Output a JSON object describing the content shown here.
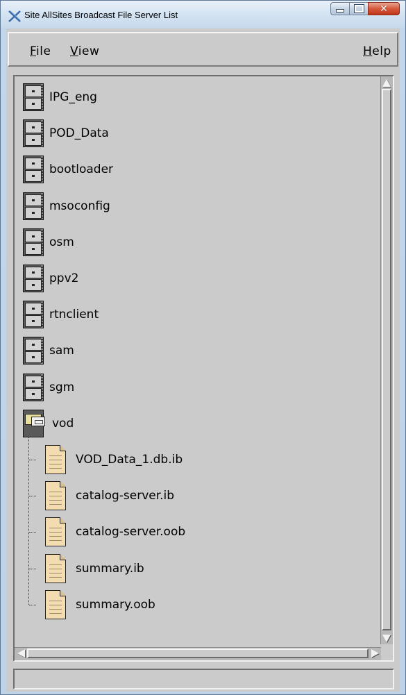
{
  "window": {
    "title": "Site AllSites Broadcast File Server List",
    "controls": {
      "minimize": "minimize",
      "maximize": "maximize",
      "close": "close"
    }
  },
  "menubar": {
    "file": "File",
    "view": "View",
    "help": "Help"
  },
  "servers": [
    {
      "label": "IPG_eng",
      "icon": "file-cabinet-icon"
    },
    {
      "label": "POD_Data",
      "icon": "file-cabinet-icon"
    },
    {
      "label": "bootloader",
      "icon": "file-cabinet-icon"
    },
    {
      "label": "msoconfig",
      "icon": "file-cabinet-icon"
    },
    {
      "label": "osm",
      "icon": "file-cabinet-icon"
    },
    {
      "label": "ppv2",
      "icon": "file-cabinet-icon"
    },
    {
      "label": "rtnclient",
      "icon": "file-cabinet-icon"
    },
    {
      "label": "sam",
      "icon": "file-cabinet-icon"
    },
    {
      "label": "sgm",
      "icon": "file-cabinet-icon"
    },
    {
      "label": "vod",
      "icon": "open-file-cabinet-icon",
      "expanded": true
    }
  ],
  "vod_files": [
    {
      "label": "VOD_Data_1.db.ib",
      "icon": "document-icon"
    },
    {
      "label": "catalog-server.ib",
      "icon": "document-icon"
    },
    {
      "label": "catalog-server.oob",
      "icon": "document-icon"
    },
    {
      "label": "summary.ib",
      "icon": "document-icon"
    },
    {
      "label": "summary.oob",
      "icon": "document-icon"
    }
  ],
  "status": {
    "text": ""
  }
}
